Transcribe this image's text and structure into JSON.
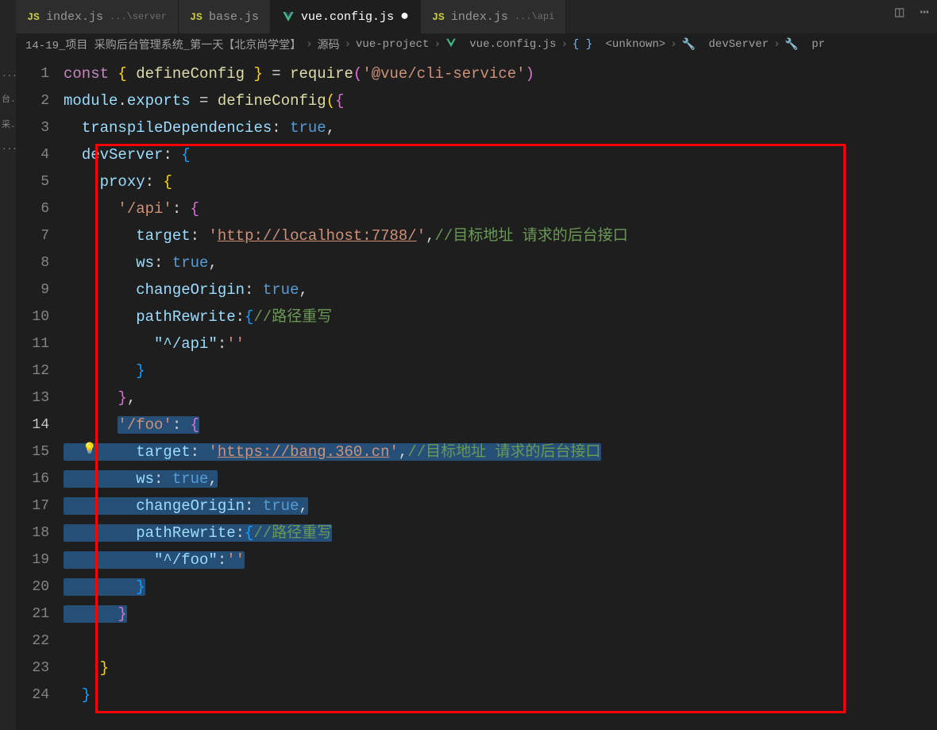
{
  "titlebar": {
    "icon1": "split-icon",
    "icon2": "more-icon"
  },
  "sidebar": {
    "items": [
      "...",
      "台...",
      "采...",
      "..."
    ]
  },
  "tabs": [
    {
      "icon": "JS",
      "label": "index.js",
      "hint": "...\\server",
      "active": false
    },
    {
      "icon": "JS",
      "label": "base.js",
      "hint": "",
      "active": false
    },
    {
      "icon": "V",
      "label": "vue.config.js",
      "hint": "",
      "active": true,
      "dirty": "●"
    },
    {
      "icon": "JS",
      "label": "index.js",
      "hint": "...\\api",
      "active": false
    }
  ],
  "breadcrumb": {
    "segs": [
      "14-19_项目 采购后台管理系统_第一天【北京尚学堂】",
      "源码",
      "vue-project",
      "vue.config.js",
      "<unknown>",
      "devServer",
      "pr"
    ]
  },
  "gutter": [
    "1",
    "2",
    "3",
    "4",
    "5",
    "6",
    "7",
    "8",
    "9",
    "10",
    "11",
    "12",
    "13",
    "14",
    "15",
    "16",
    "17",
    "18",
    "19",
    "20",
    "21",
    "22",
    "23",
    "24"
  ],
  "code": {
    "l1": {
      "kw1": "const",
      "br": "{ ",
      "fn": "defineConfig",
      "br2": " }",
      "op": " = ",
      "req": "require",
      "p1": "(",
      "s": "'@vue/cli-service'",
      "p2": ")"
    },
    "l2": {
      "mod": "module",
      "d": ".",
      "exp": "exports",
      "op": " = ",
      "fn": "defineConfig",
      "p1": "(",
      "br": "{"
    },
    "l3": {
      "pad": "  ",
      "k": "transpileDependencies",
      "c": ": ",
      "v": "true",
      "t": ","
    },
    "l4": {
      "pad": "  ",
      "k": "devServer",
      "c": ": ",
      "br": "{"
    },
    "l5": {
      "pad": "    ",
      "k": "proxy",
      "c": ": ",
      "br": "{"
    },
    "l6": {
      "pad": "      ",
      "k": "'/api'",
      "c": ": ",
      "br": "{"
    },
    "l7": {
      "pad": "        ",
      "k": "target",
      "c": ": ",
      "s": "'",
      "url": "http://localhost:7788/",
      "s2": "'",
      "t": ",",
      "cm": "//目标地址 请求的后台接口"
    },
    "l8": {
      "pad": "        ",
      "k": "ws",
      "c": ": ",
      "v": "true",
      "t": ","
    },
    "l9": {
      "pad": "        ",
      "k": "changeOrigin",
      "c": ": ",
      "v": "true",
      "t": ","
    },
    "l10": {
      "pad": "        ",
      "k": "pathRewrite",
      "c": ":",
      "br": "{",
      "cm": "//路径重写"
    },
    "l11": {
      "pad": "          ",
      "k": "\"^/api\"",
      "c": ":",
      "v": "''"
    },
    "l12": {
      "pad": "        ",
      "br": "}"
    },
    "l13": {
      "pad": "      ",
      "br": "}",
      "t": ","
    },
    "l14": {
      "pad": "      ",
      "k": "'/foo'",
      "c": ": ",
      "br": "{"
    },
    "l15": {
      "pad": "        ",
      "k": "target",
      "c": ": ",
      "s": "'",
      "url": "https://bang.360.cn",
      "s2": "'",
      "t": ",",
      "cm": "//目标地址 请求的后台接口"
    },
    "l16": {
      "pad": "        ",
      "k": "ws",
      "c": ": ",
      "v": "true",
      "t": ","
    },
    "l17": {
      "pad": "        ",
      "k": "changeOrigin",
      "c": ": ",
      "v": "true",
      "t": ","
    },
    "l18": {
      "pad": "        ",
      "k": "pathRewrite",
      "c": ":",
      "br": "{",
      "cm": "//路径重写"
    },
    "l19": {
      "pad": "          ",
      "k": "\"^/foo\"",
      "c": ":",
      "v": "''"
    },
    "l20": {
      "pad": "        ",
      "br": "}"
    },
    "l21": {
      "pad": "      ",
      "br": "}"
    },
    "l22": {
      "pad": ""
    },
    "l23": {
      "pad": "    ",
      "br": "}"
    },
    "l24": {
      "pad": "  ",
      "br": "}"
    }
  }
}
